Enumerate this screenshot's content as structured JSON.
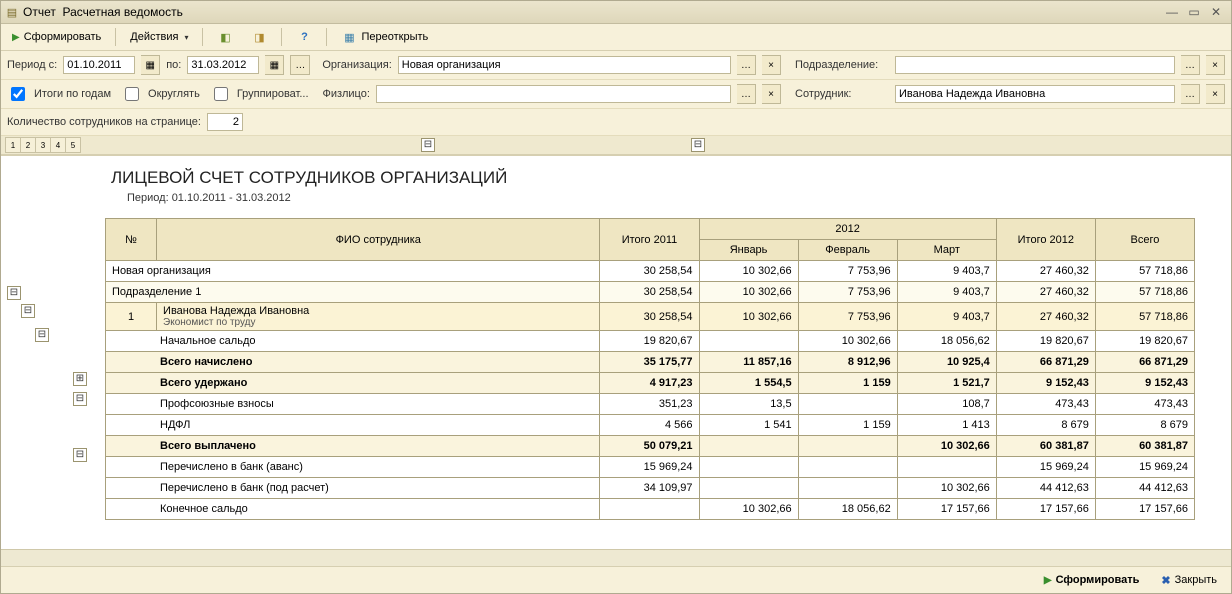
{
  "window": {
    "title_a": "Отчет",
    "title_b": "Расчетная ведомость"
  },
  "toolbar": {
    "form": "Сформировать",
    "actions": "Действия",
    "help": "?",
    "reopen": "Переоткрыть"
  },
  "filters": {
    "period_from_lbl": "Период с:",
    "period_from": "01.10.2011",
    "period_to_lbl": "по:",
    "period_to": "31.03.2012",
    "org_lbl": "Организация:",
    "org": "Новая организация",
    "dept_lbl": "Подразделение:",
    "dept": "",
    "itogi_label": "Итоги по годам",
    "okrug_label": "Округлять",
    "group_label": "Группироват...",
    "fizlico_lbl": "Физлицо:",
    "fizlico": "",
    "sotr_lbl": "Сотрудник:",
    "sotr": "Иванова Надежда Ивановна",
    "count_lbl": "Количество сотрудников на странице:",
    "count_val": "2"
  },
  "report": {
    "title": "ЛИЦЕВОЙ СЧЕТ СОТРУДНИКОВ ОРГАНИЗАЦИЙ",
    "subtitle": "Период: 01.10.2011 - 31.03.2012",
    "head": {
      "no": "№",
      "fio": "ФИО сотрудника",
      "y2011": "Итого 2011",
      "y2012": "2012",
      "jan": "Январь",
      "feb": "Февраль",
      "mar": "Март",
      "ty2012": "Итого 2012",
      "total": "Всего"
    },
    "rows": [
      {
        "cls": "r-org",
        "name": "Новая организация",
        "v": [
          "30 258,54",
          "10 302,66",
          "7 753,96",
          "9 403,7",
          "27 460,32",
          "57 718,86"
        ]
      },
      {
        "cls": "r-dept",
        "name": "Подразделение 1",
        "v": [
          "30 258,54",
          "10 302,66",
          "7 753,96",
          "9 403,7",
          "27 460,32",
          "57 718,86"
        ]
      },
      {
        "cls": "r-emp",
        "no": "1",
        "name": "Иванова Надежда Ивановна",
        "sub": "Экономист по труду",
        "v": [
          "30 258,54",
          "10 302,66",
          "7 753,96",
          "9 403,7",
          "27 460,32",
          "57 718,86"
        ]
      },
      {
        "cls": "r-plain",
        "name": "Начальное сальдо",
        "v": [
          "19 820,67",
          "",
          "10 302,66",
          "18 056,62",
          "19 820,67",
          "19 820,67"
        ]
      },
      {
        "cls": "r-bold-h",
        "name": "Всего начислено",
        "v": [
          "35 175,77",
          "11 857,16",
          "8 912,96",
          "10 925,4",
          "66 871,29",
          "66 871,29"
        ]
      },
      {
        "cls": "r-bold-h",
        "name": "Всего удержано",
        "v": [
          "4 917,23",
          "1 554,5",
          "1 159",
          "1 521,7",
          "9 152,43",
          "9 152,43"
        ]
      },
      {
        "cls": "r-plain",
        "name": "Профсоюзные взносы",
        "v": [
          "351,23",
          "13,5",
          "",
          "108,7",
          "473,43",
          "473,43"
        ]
      },
      {
        "cls": "r-plain",
        "name": "НДФЛ",
        "v": [
          "4 566",
          "1 541",
          "1 159",
          "1 413",
          "8 679",
          "8 679"
        ]
      },
      {
        "cls": "r-bold-h",
        "name": "Всего выплачено",
        "v": [
          "50 079,21",
          "",
          "",
          "10 302,66",
          "60 381,87",
          "60 381,87"
        ]
      },
      {
        "cls": "r-plain",
        "name": "Перечислено в банк (аванс)",
        "v": [
          "15 969,24",
          "",
          "",
          "",
          "15 969,24",
          "15 969,24"
        ]
      },
      {
        "cls": "r-plain",
        "name": "Перечислено в банк (под расчет)",
        "v": [
          "34 109,97",
          "",
          "",
          "10 302,66",
          "44 412,63",
          "44 412,63"
        ]
      },
      {
        "cls": "r-plain",
        "name": "Конечное сальдо",
        "v": [
          "",
          "10 302,66",
          "18 056,62",
          "17 157,66",
          "17 157,66",
          "17 157,66"
        ]
      }
    ]
  },
  "bottom": {
    "form": "Сформировать",
    "close": "Закрыть"
  }
}
